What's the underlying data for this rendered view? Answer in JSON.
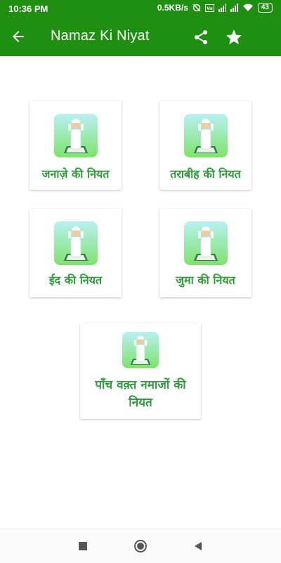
{
  "status_bar": {
    "time": "10:36 PM",
    "network_speed": "0.5KB/s",
    "battery": "43"
  },
  "app_bar": {
    "title": "Namaz Ki Niyat",
    "back_icon": "arrow-back-icon",
    "share_icon": "share-icon",
    "favorite_icon": "star-icon"
  },
  "colors": {
    "primary": "#1f8f12",
    "label_green": "#2e9a39"
  },
  "cards": [
    {
      "label": "जनाज़े की नियत"
    },
    {
      "label": "तराबीह की नियत"
    },
    {
      "label": "ईद की नियत"
    },
    {
      "label": "जुमा की नियत"
    },
    {
      "label": "पाँच वक़्त नमाजों की नियत"
    }
  ],
  "nav_bar": {
    "recents_icon": "square-icon",
    "home_icon": "circle-icon",
    "back_icon": "triangle-back-icon"
  }
}
